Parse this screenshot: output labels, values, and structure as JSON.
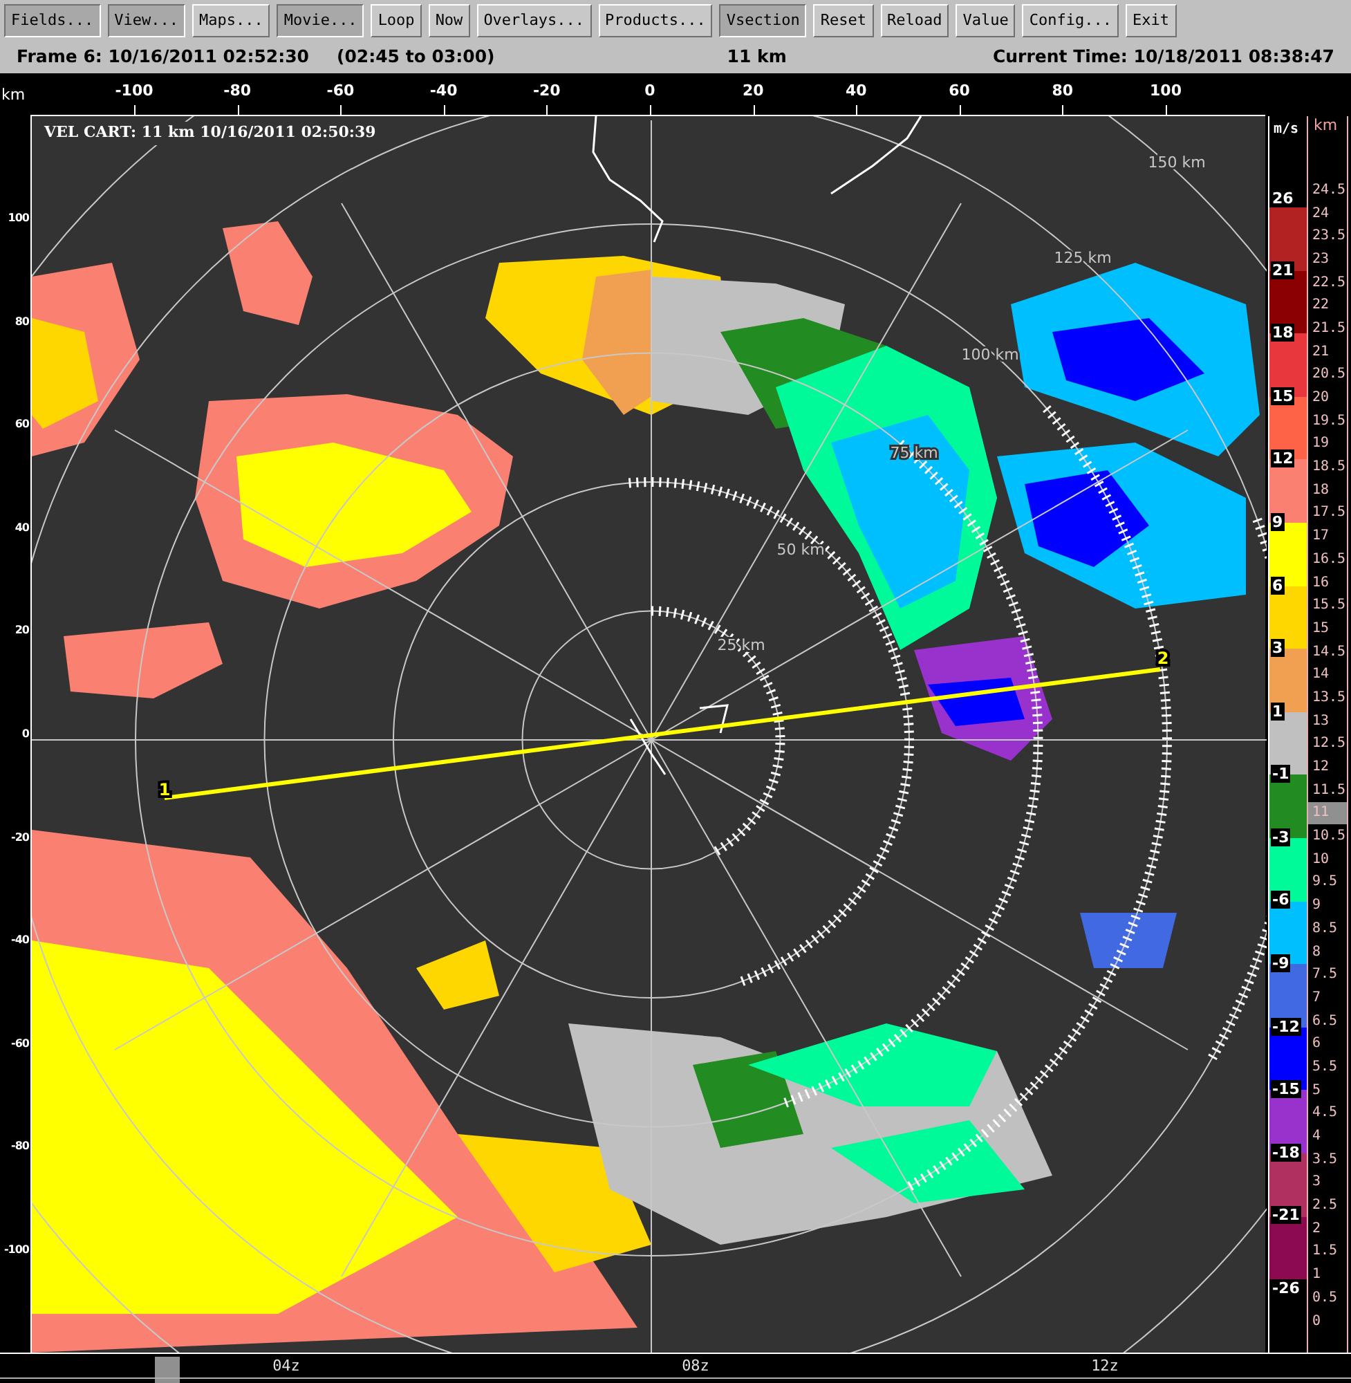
{
  "toolbar": {
    "buttons": [
      {
        "label": "Fields...",
        "active": true
      },
      {
        "label": "View...",
        "active": true
      },
      {
        "label": "Maps...",
        "active": false
      },
      {
        "label": "Movie...",
        "active": true
      },
      {
        "label": "Loop",
        "active": false
      },
      {
        "label": "Now",
        "active": false
      },
      {
        "label": "Overlays...",
        "active": false
      },
      {
        "label": "Products...",
        "active": false
      },
      {
        "label": "Vsection",
        "active": true
      },
      {
        "label": "Reset",
        "active": false
      },
      {
        "label": "Reload",
        "active": false
      },
      {
        "label": "Value",
        "active": false
      },
      {
        "label": "Config...",
        "active": false
      },
      {
        "label": "Exit",
        "active": false
      }
    ]
  },
  "status": {
    "frame": "Frame 6: 10/16/2011 02:52:30",
    "interval": "(02:45 to 03:00)",
    "height": "11 km",
    "current_time": "Current Time: 10/18/2011 08:38:47"
  },
  "plot": {
    "axis_unit": "km",
    "x_ticks": [
      "-100",
      "-80",
      "-60",
      "-40",
      "-20",
      "0",
      "20",
      "40",
      "60",
      "80",
      "100"
    ],
    "y_ticks": [
      "100",
      "80",
      "60",
      "40",
      "20",
      "0",
      "-20",
      "-40",
      "-60",
      "-80",
      "-100"
    ],
    "title": "VEL CART: 11 km 10/16/2011 02:50:39",
    "range_rings": [
      "25 km",
      "50 km",
      "75 km",
      "100 km",
      "125 km",
      "150 km"
    ],
    "section_points": [
      "1",
      "2"
    ]
  },
  "color_scale": {
    "unit": "m/s",
    "labels": [
      "26",
      "21",
      "18",
      "15",
      "12",
      "9",
      "6",
      "3",
      "1",
      "-1",
      "-3",
      "-6",
      "-9",
      "-12",
      "-15",
      "-18",
      "-21",
      "-26"
    ],
    "bands": [
      {
        "color": "#b22222"
      },
      {
        "color": "#8b0000"
      },
      {
        "color": "#e8383d"
      },
      {
        "color": "#ff6347"
      },
      {
        "color": "#fa8072"
      },
      {
        "color": "#ffff00"
      },
      {
        "color": "#ffd700"
      },
      {
        "color": "#f0a050"
      },
      {
        "color": "#c0c0c0"
      },
      {
        "color": "#228b22"
      },
      {
        "color": "#00fa9a"
      },
      {
        "color": "#00bfff"
      },
      {
        "color": "#4169e1"
      },
      {
        "color": "#0000ff"
      },
      {
        "color": "#9932cc"
      },
      {
        "color": "#b03060"
      },
      {
        "color": "#8b0a50"
      }
    ]
  },
  "height_scale": {
    "unit": "km",
    "levels": [
      {
        "label": "24.5",
        "selected": false
      },
      {
        "label": "24",
        "selected": false
      },
      {
        "label": "23.5",
        "selected": false
      },
      {
        "label": "23",
        "selected": false
      },
      {
        "label": "22.5",
        "selected": false
      },
      {
        "label": "22",
        "selected": false
      },
      {
        "label": "21.5",
        "selected": false
      },
      {
        "label": "21",
        "selected": false
      },
      {
        "label": "20.5",
        "selected": false
      },
      {
        "label": "20",
        "selected": false
      },
      {
        "label": "19.5",
        "selected": false
      },
      {
        "label": "19",
        "selected": false
      },
      {
        "label": "18.5",
        "selected": false
      },
      {
        "label": "18",
        "selected": false
      },
      {
        "label": "17.5",
        "selected": false
      },
      {
        "label": "17",
        "selected": false
      },
      {
        "label": "16.5",
        "selected": false
      },
      {
        "label": "16",
        "selected": false
      },
      {
        "label": "15.5",
        "selected": false
      },
      {
        "label": "15",
        "selected": false
      },
      {
        "label": "14.5",
        "selected": false
      },
      {
        "label": "14",
        "selected": false
      },
      {
        "label": "13.5",
        "selected": false
      },
      {
        "label": "13",
        "selected": false
      },
      {
        "label": "12.5",
        "selected": false
      },
      {
        "label": "12",
        "selected": false
      },
      {
        "label": "11.5",
        "selected": false
      },
      {
        "label": "11",
        "selected": true
      },
      {
        "label": "10.5",
        "selected": false
      },
      {
        "label": "10",
        "selected": false
      },
      {
        "label": "9.5",
        "selected": false
      },
      {
        "label": "9",
        "selected": false
      },
      {
        "label": "8.5",
        "selected": false
      },
      {
        "label": "8",
        "selected": false
      },
      {
        "label": "7.5",
        "selected": false
      },
      {
        "label": "7",
        "selected": false
      },
      {
        "label": "6.5",
        "selected": false
      },
      {
        "label": "6",
        "selected": false
      },
      {
        "label": "5.5",
        "selected": false
      },
      {
        "label": "5",
        "selected": false
      },
      {
        "label": "4.5",
        "selected": false
      },
      {
        "label": "4",
        "selected": false
      },
      {
        "label": "3.5",
        "selected": false
      },
      {
        "label": "3",
        "selected": false
      },
      {
        "label": "2.5",
        "selected": false
      },
      {
        "label": "2",
        "selected": false
      },
      {
        "label": "1.5",
        "selected": false
      },
      {
        "label": "1",
        "selected": false
      },
      {
        "label": "0.5",
        "selected": false
      },
      {
        "label": "0",
        "selected": false
      }
    ]
  },
  "timeline": {
    "labels": [
      "04z",
      "08z",
      "12z"
    ]
  }
}
